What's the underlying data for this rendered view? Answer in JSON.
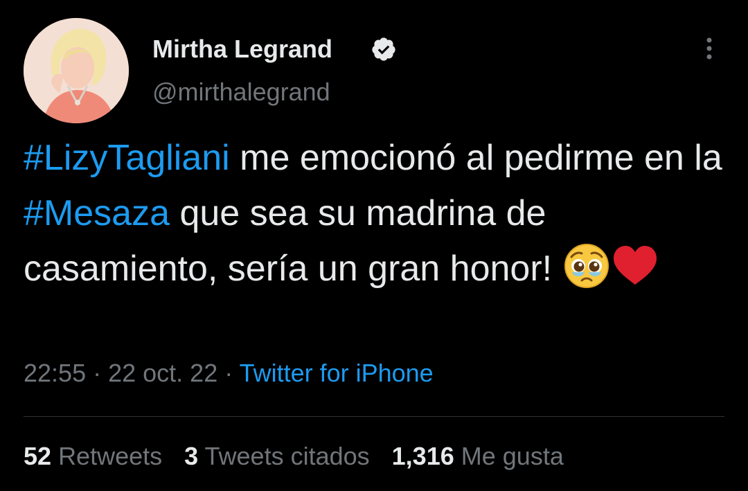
{
  "author": {
    "display_name": "Mirtha Legrand",
    "handle": "@mirthalegrand",
    "verified": true,
    "avatar_icon": "profile-photo-avatar"
  },
  "tweet": {
    "hashtag_1": "#LizyTagliani",
    "text_1": " me emocionó al pedirme en la ",
    "hashtag_2": "#Mesaza",
    "text_2": " que sea su madrina de casamiento, sería un gran honor! ",
    "emojis": [
      "pleading-face-emoji",
      "red-heart-emoji"
    ]
  },
  "meta": {
    "time": "22:55",
    "sep1": " · ",
    "date": "22 oct. 22",
    "sep2": " · ",
    "source": "Twitter for iPhone"
  },
  "stats": {
    "retweets_count": "52",
    "retweets_label": "Retweets",
    "quotes_count": "3",
    "quotes_label": "Tweets citados",
    "likes_count": "1,316",
    "likes_label": "Me gusta"
  },
  "colors": {
    "background": "#000000",
    "text": "#e7e9ea",
    "secondary_text": "#71767b",
    "link": "#1d9bf0",
    "divider": "#2f3336"
  }
}
